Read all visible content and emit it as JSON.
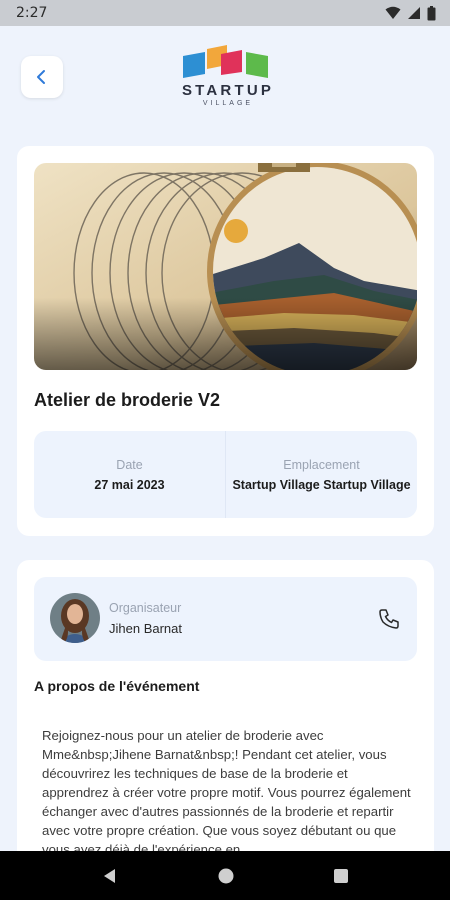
{
  "status_bar": {
    "time": "2:27"
  },
  "header": {
    "logo_text": "STARTUP",
    "logo_subtext": "VILLAGE",
    "back_icon": "chevron-left-icon"
  },
  "event": {
    "title": "Atelier de broderie V2",
    "date_label": "Date",
    "date_value": "27 mai 2023",
    "location_label": "Emplacement",
    "location_value": "Startup Village Startup Village"
  },
  "organizer": {
    "label": "Organisateur",
    "name": "Jihen Barnat",
    "phone_icon": "phone-icon"
  },
  "about": {
    "title": "A propos de l'événement",
    "text": "Rejoignez-nous pour un atelier de broderie avec Mme&nbsp;Jihene Barnat&nbsp;! Pendant cet atelier, vous découvrirez les techniques de base de la broderie et apprendrez à créer votre propre motif. Vous pourrez également échanger avec d'autres passionnés de la broderie et repartir avec votre propre création. Que vous soyez débutant ou que vous ayez déjà de l'expérience en"
  },
  "colors": {
    "background": "#eef3fc",
    "card": "#ffffff",
    "info_box": "#edf3fd",
    "accent": "#2f7ad9"
  }
}
